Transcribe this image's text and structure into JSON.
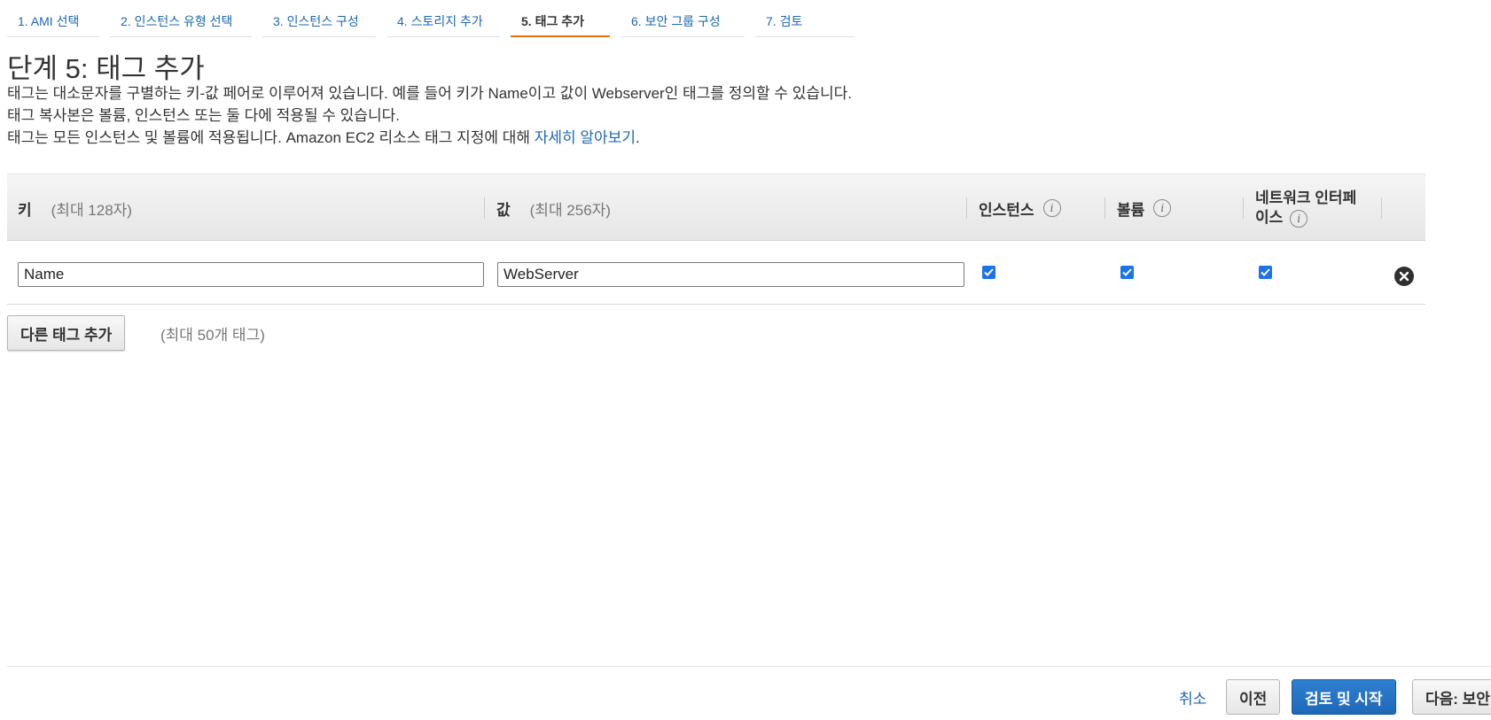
{
  "wizard": {
    "tabs": [
      {
        "label": "1. AMI 선택"
      },
      {
        "label": "2. 인스턴스 유형 선택"
      },
      {
        "label": "3. 인스턴스 구성"
      },
      {
        "label": "4. 스토리지 추가"
      },
      {
        "label": "5. 태그 추가"
      },
      {
        "label": "6. 보안 그룹 구성"
      },
      {
        "label": "7. 검토"
      }
    ],
    "active_index": 4
  },
  "page": {
    "title": "단계 5: 태그 추가",
    "desc_line1": "태그는 대소문자를 구별하는 키-값 페어로 이루어져 있습니다. 예를 들어 키가 Name이고 값이 Webserver인 태그를 정의할 수 있습니다.",
    "desc_line2": "태그 복사본은 볼륨, 인스턴스 또는 둘 다에 적용될 수 있습니다.",
    "desc_line3_prefix": "태그는 모든 인스턴스 및 볼륨에 적용됩니다. Amazon EC2 리소스 태그 지정에 대해 ",
    "desc_line3_link": "자세히 알아보기",
    "desc_line3_suffix": "."
  },
  "table": {
    "headers": {
      "key": "키",
      "key_hint": "(최대 128자)",
      "value": "값",
      "value_hint": "(최대 256자)",
      "instances": "인스턴스",
      "volumes": "볼륨",
      "network_interfaces_line1": "네트워크 인터페",
      "network_interfaces_line2": "이스"
    },
    "rows": [
      {
        "key": "Name",
        "value": "WebServer",
        "instances": true,
        "volumes": true,
        "network_interfaces": true
      }
    ]
  },
  "actions": {
    "add_tag_label": "다른 태그 추가",
    "add_tag_limit": "(최대 50개 태그)"
  },
  "footer": {
    "cancel_label": "취소",
    "previous_label": "이전",
    "review_launch_label": "검토 및 시작",
    "next_label": "다음: 보안"
  },
  "colors": {
    "link": "#1d68b3",
    "active_tab_underline": "#ec7211",
    "primary_button": "#1e69b8",
    "checkbox": "#1a73e8"
  }
}
